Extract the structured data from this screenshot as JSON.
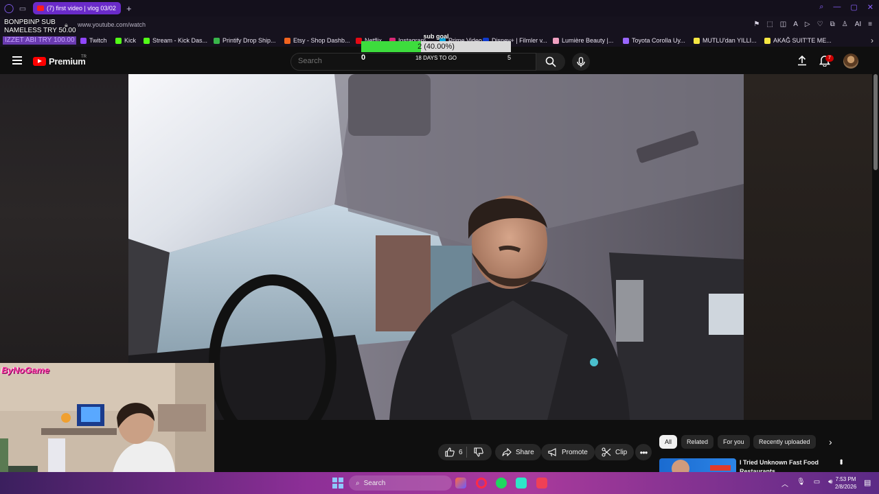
{
  "browser": {
    "tab_title": "(7) first video | vlog 03/02",
    "url": "www.youtube.com/watch",
    "bookmarks": [
      {
        "label": "Twitch",
        "color": "#9146ff"
      },
      {
        "label": "Kick",
        "color": "#53fc18"
      },
      {
        "label": "Stream - Kick Das...",
        "color": "#53fc18"
      },
      {
        "label": "Printify Drop Ship...",
        "color": "#39b54a"
      },
      {
        "label": "Etsy - Shop Dashb...",
        "color": "#f1641e"
      },
      {
        "label": "Netflix",
        "color": "#e50914"
      },
      {
        "label": "Instagram",
        "color": "#d62976"
      },
      {
        "label": "Prime Video",
        "color": "#00a8e1"
      },
      {
        "label": "Disney+ | Filmler v...",
        "color": "#113ccf"
      },
      {
        "label": "Lumière Beauty |...",
        "color": "#f0a0c0"
      },
      {
        "label": "Toyota Corolla Uy...",
        "color": "#9a66ff"
      },
      {
        "label": "MUTLU'dan YILLI...",
        "color": "#f5e642"
      },
      {
        "label": "AKAĞ SUIT'TE ME...",
        "color": "#f5e642"
      }
    ],
    "toolbar_ai_label": "AI"
  },
  "stream_overlay": {
    "sub_line1": "BONPBINP  SUB",
    "sub_line2": "NAMELESS  TRY 50.00",
    "sub_line3": "IZZET ABI  TRY 100.00",
    "sub_goal": {
      "title": "sub goal",
      "current": 2,
      "percent_label": "2 (40.00%)",
      "progress": 0.4,
      "min": "0",
      "max": "5",
      "days_label": "18 DAYS TO GO"
    },
    "webcam_brand": "ByNoGame"
  },
  "youtube": {
    "logo_text": "Premium",
    "country_code": "TR",
    "search_placeholder": "Search",
    "notification_count": "7",
    "actions": {
      "likes": "6",
      "share": "Share",
      "promote": "Promote",
      "clip": "Clip"
    },
    "filter_chips": [
      "All",
      "Related",
      "For you",
      "Recently uploaded"
    ],
    "recommended": [
      {
        "title": "I Tried Unknown Fast Food Restaurants"
      }
    ]
  },
  "taskbar": {
    "search_label": "Search",
    "time": "7:53 PM",
    "date": "2/8/2026"
  },
  "colors": {
    "accent_purple": "#6a2bc9",
    "yt_red": "#ff0000",
    "goal_green": "#3ddc3d"
  }
}
